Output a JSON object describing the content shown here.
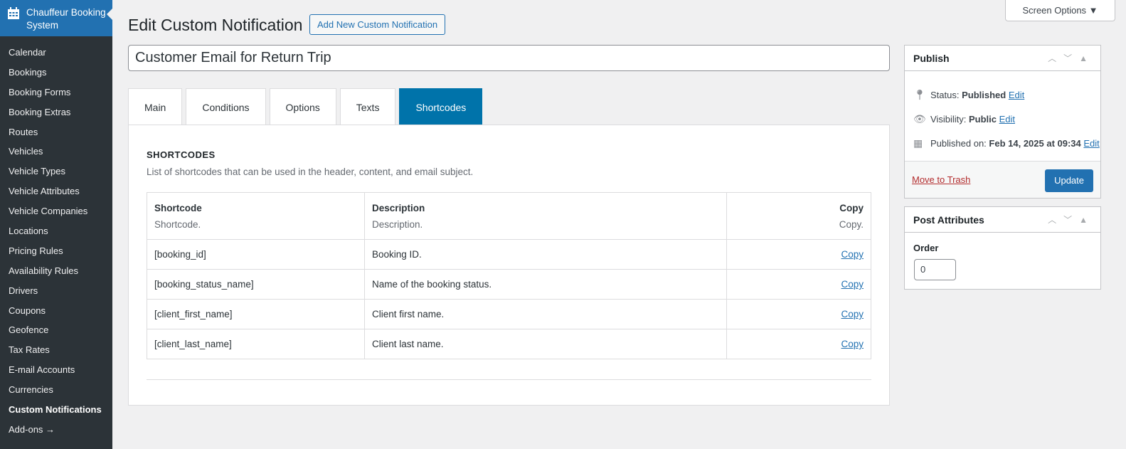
{
  "brand": "Chauffeur Booking System",
  "menu": [
    "Calendar",
    "Bookings",
    "Booking Forms",
    "Booking Extras",
    "Routes",
    "Vehicles",
    "Vehicle Types",
    "Vehicle Attributes",
    "Vehicle Companies",
    "Locations",
    "Pricing Rules",
    "Availability Rules",
    "Drivers",
    "Coupons",
    "Geofence",
    "Tax Rates",
    "E-mail Accounts",
    "Currencies",
    "Custom Notifications",
    "Add-ons →"
  ],
  "header": {
    "title": "Edit Custom Notification",
    "add_new": "Add New Custom Notification",
    "screen_options": "Screen Options ▼"
  },
  "post_title": "Customer Email for Return Trip",
  "tabs": [
    "Main",
    "Conditions",
    "Options",
    "Texts",
    "Shortcodes"
  ],
  "section": {
    "title": "SHORTCODES",
    "subtitle": "List of shortcodes that can be used in the header, content, and email subject.",
    "columns": [
      {
        "label": "Shortcode",
        "sub": "Shortcode."
      },
      {
        "label": "Description",
        "sub": "Description."
      },
      {
        "label": "Copy",
        "sub": "Copy."
      }
    ],
    "rows": [
      {
        "code": "[booking_id]",
        "desc": "Booking ID.",
        "copy": "Copy"
      },
      {
        "code": "[booking_status_name]",
        "desc": "Name of the booking status.",
        "copy": "Copy"
      },
      {
        "code": "[client_first_name]",
        "desc": "Client first name.",
        "copy": "Copy"
      },
      {
        "code": "[client_last_name]",
        "desc": "Client last name.",
        "copy": "Copy"
      }
    ]
  },
  "publish": {
    "title": "Publish",
    "status_label": "Status:",
    "status": "Published",
    "visibility_label": "Visibility:",
    "visibility": "Public",
    "published_label": "Published on:",
    "published": "Feb 14, 2025 at 09:34",
    "edit": "Edit",
    "trash": "Move to Trash",
    "update": "Update"
  },
  "attributes": {
    "title": "Post Attributes",
    "order_label": "Order",
    "order": "0"
  }
}
